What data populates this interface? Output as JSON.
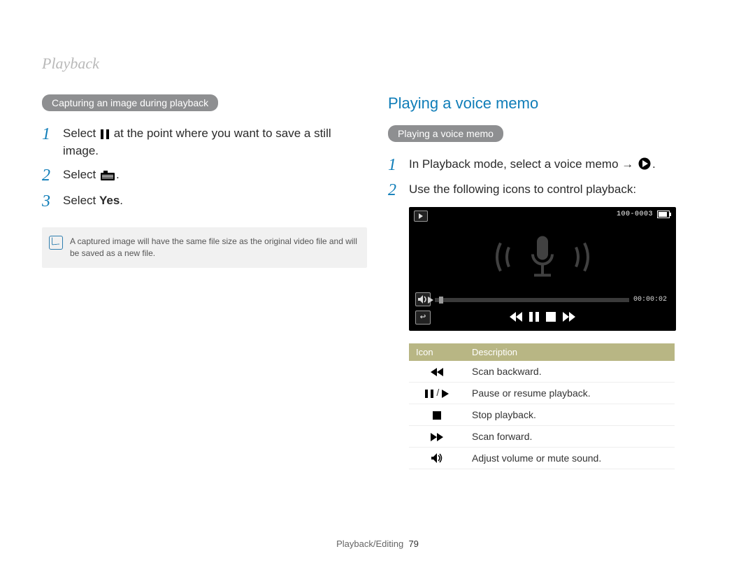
{
  "header": {
    "title": "Playback"
  },
  "left": {
    "pill": "Capturing an image during playback",
    "steps": [
      {
        "pre": "Select ",
        "post": " at the point where you want to save a still image."
      },
      {
        "pre": "Select ",
        "post": "."
      },
      {
        "pre": "Select ",
        "bold": "Yes",
        "post": "."
      }
    ],
    "note": "A captured image will have the same file size as the original video file and will be saved as a new file."
  },
  "right": {
    "heading": "Playing a voice memo",
    "pill": "Playing a voice memo",
    "steps": [
      {
        "pre": "In Playback mode, select a voice memo → ",
        "post": "."
      },
      {
        "text": "Use the following icons to control playback:"
      }
    ],
    "memo": {
      "folder": "100-0003",
      "time": "00:00:02"
    },
    "table": {
      "headers": {
        "icon": "Icon",
        "desc": "Description"
      },
      "rows": [
        {
          "icon": "rewind",
          "desc": "Scan backward."
        },
        {
          "icon": "pauseplay",
          "desc": "Pause or resume playback."
        },
        {
          "icon": "stop",
          "desc": "Stop playback."
        },
        {
          "icon": "forward",
          "desc": "Scan forward."
        },
        {
          "icon": "volume",
          "desc": "Adjust volume or mute sound."
        }
      ]
    }
  },
  "footer": {
    "section": "Playback/Editing",
    "page": "79"
  }
}
